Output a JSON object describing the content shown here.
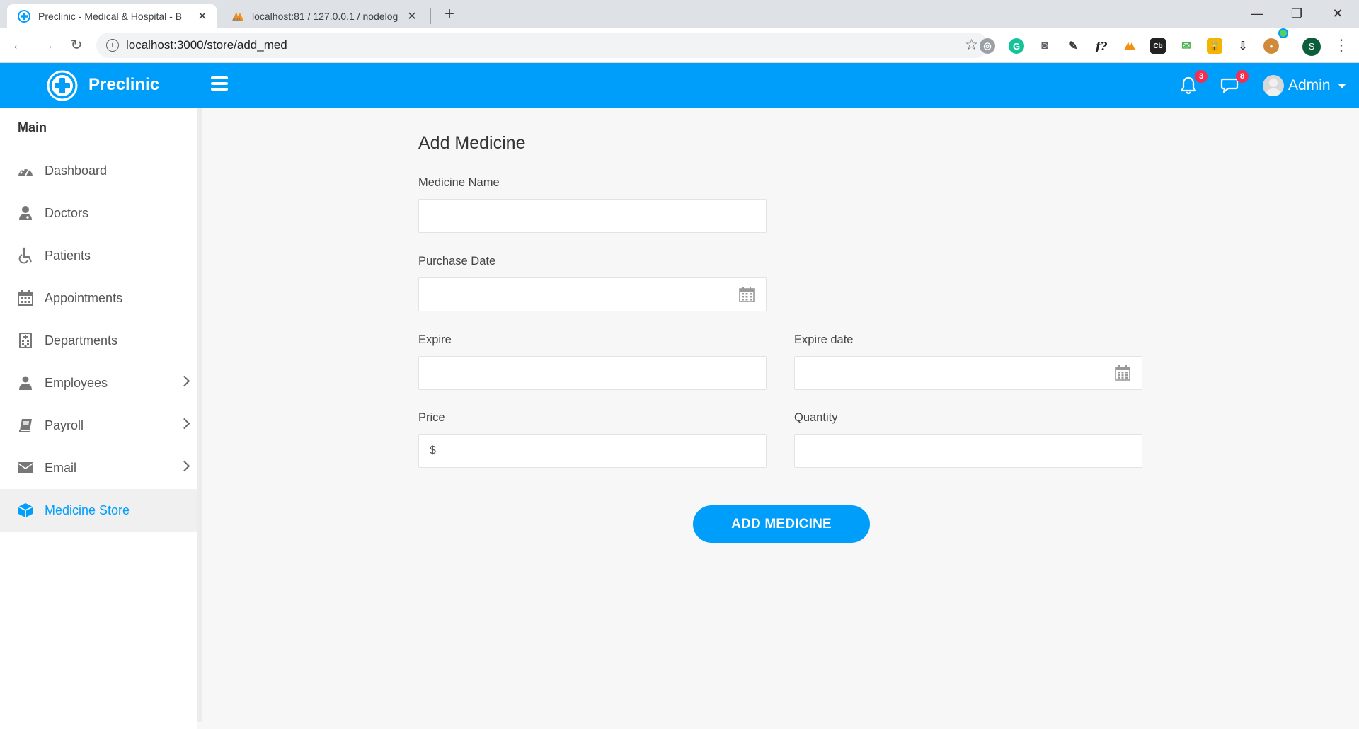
{
  "browser": {
    "tabs": [
      {
        "title": "Preclinic - Medical & Hospital - B"
      },
      {
        "title": "localhost:81 / 127.0.0.1 / nodelog"
      }
    ],
    "url": "localhost:3000/store/add_med",
    "profile_initial": "S",
    "extensions": [
      "f?",
      "Cb"
    ]
  },
  "header": {
    "brand": "Preclinic",
    "notifications_count": "3",
    "messages_count": "8",
    "user_name": "Admin"
  },
  "sidebar": {
    "section": "Main",
    "items": [
      {
        "label": "Dashboard"
      },
      {
        "label": "Doctors"
      },
      {
        "label": "Patients"
      },
      {
        "label": "Appointments"
      },
      {
        "label": "Departments"
      },
      {
        "label": "Employees"
      },
      {
        "label": "Payroll"
      },
      {
        "label": "Email"
      },
      {
        "label": "Medicine Store"
      }
    ]
  },
  "form": {
    "title": "Add Medicine",
    "medicine_name_label": "Medicine Name",
    "medicine_name_value": "",
    "purchase_date_label": "Purchase Date",
    "purchase_date_value": "",
    "expire_label": "Expire",
    "expire_value": "",
    "expire_date_label": "Expire date",
    "expire_date_value": "",
    "price_label": "Price",
    "price_prefix": "$",
    "price_value": "",
    "quantity_label": "Quantity",
    "quantity_value": "",
    "submit_label": "ADD MEDICINE"
  },
  "colors": {
    "primary": "#009efb",
    "badge": "#f62d51",
    "online": "#55ce63"
  }
}
